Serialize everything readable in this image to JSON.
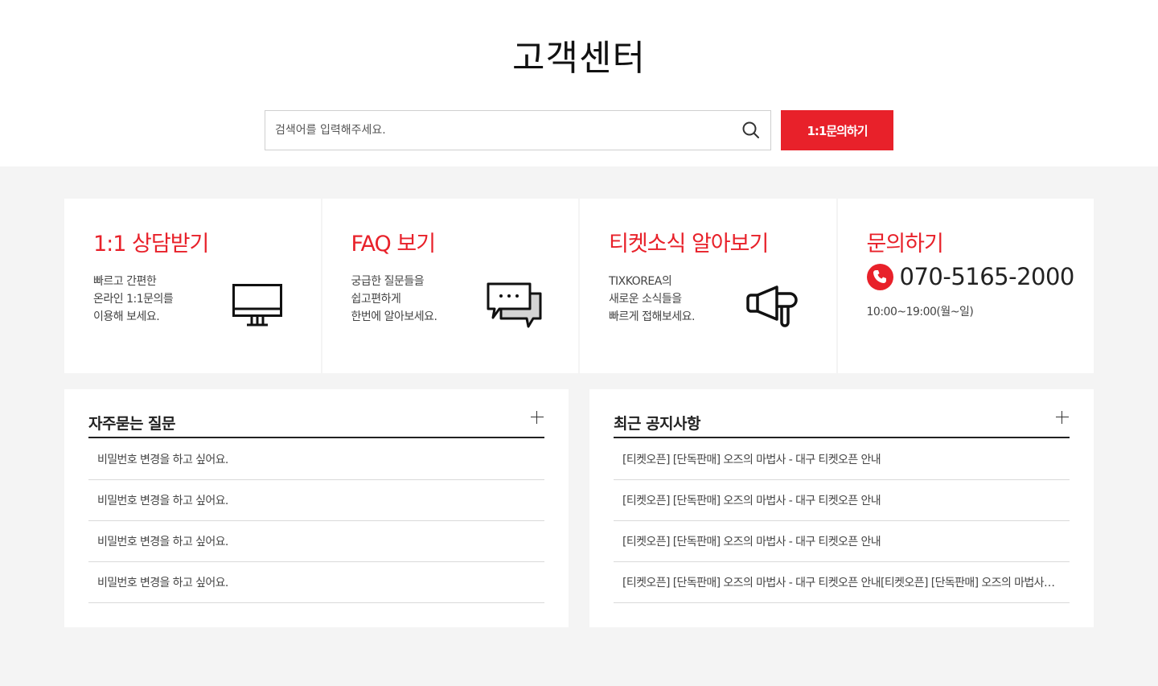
{
  "header": {
    "title": "고객센터",
    "search_placeholder": "검색어를 입력해주세요.",
    "search_icon": "search-icon",
    "inquiry_button": "1:1문의하기"
  },
  "cards": [
    {
      "title": "1:1 상담받기",
      "lines": [
        "빠르고 간편한",
        "온라인 1:1문의를",
        "이용해 보세요."
      ],
      "icon": "monitor-icon"
    },
    {
      "title": "FAQ 보기",
      "lines": [
        "궁급한 질문들을",
        "쉽고편하게",
        "한번에 알아보세요."
      ],
      "icon": "chat-bubbles-icon"
    },
    {
      "title": "티켓소식 알아보기",
      "lines": [
        "TIXKOREA의",
        "새로운 소식들을",
        "빠르게 접해보세요."
      ],
      "icon": "megaphone-icon"
    },
    {
      "title": "문의하기",
      "phone": "070-5165-2000",
      "hours": "10:00~19:00(월~일)",
      "icon": "phone-icon"
    }
  ],
  "faq": {
    "title": "자주묻는 질문",
    "items": [
      "비밀번호 변경을 하고 싶어요.",
      "비밀번호 변경을 하고 싶어요.",
      "비밀번호 변경을 하고 싶어요.",
      "비밀번호 변경을 하고 싶어요."
    ]
  },
  "notices": {
    "title": "최근 공지사항",
    "items": [
      "[티켓오픈] [단독판매] 오즈의 마법사 - 대구 티켓오픈 안내",
      "[티켓오픈] [단독판매] 오즈의 마법사 - 대구 티켓오픈 안내",
      "[티켓오픈] [단독판매] 오즈의 마법사 - 대구 티켓오픈 안내",
      "[티켓오픈] [단독판매] 오즈의 마법사 - 대구 티켓오픈 안내[티켓오픈] [단독판매] 오즈의 마법사 - 대구 티켓오픈 안내"
    ]
  },
  "colors": {
    "accent": "#e8212a",
    "background": "#f4f4f4"
  }
}
